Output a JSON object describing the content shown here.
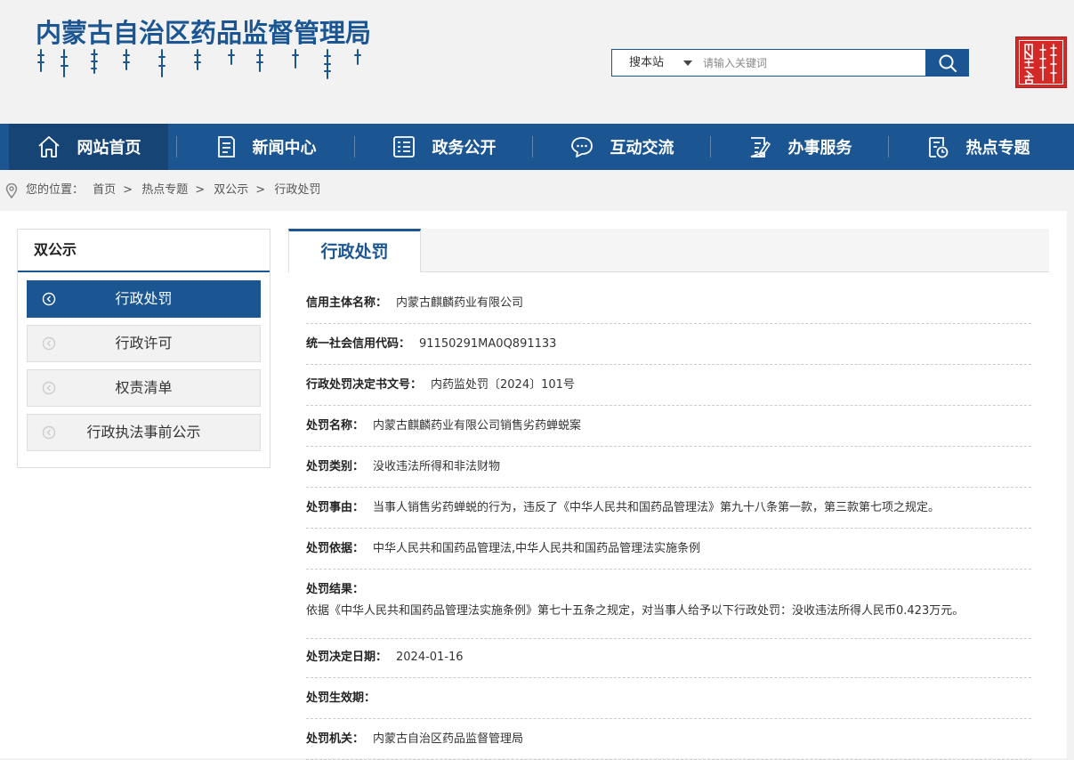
{
  "header": {
    "site_title": "内蒙古自治区药品监督管理局",
    "search": {
      "scope_label": "搜本站",
      "placeholder": "请输入关键词"
    },
    "seal_text": "内蒙古"
  },
  "nav": {
    "items": [
      {
        "label": "网站首页",
        "icon": "home-icon"
      },
      {
        "label": "新闻中心",
        "icon": "document-icon"
      },
      {
        "label": "政务公开",
        "icon": "list-panel-icon"
      },
      {
        "label": "互动交流",
        "icon": "chat-icon"
      },
      {
        "label": "办事服务",
        "icon": "edit-form-icon"
      },
      {
        "label": "热点专题",
        "icon": "clipboard-clock-icon"
      }
    ]
  },
  "breadcrumb": {
    "prefix": "您的位置：",
    "items": [
      "首页",
      "热点专题",
      "双公示",
      "行政处罚"
    ],
    "separator": ">"
  },
  "sidebar": {
    "title": "双公示",
    "items": [
      {
        "label": "行政处罚"
      },
      {
        "label": "行政许可"
      },
      {
        "label": "权责清单"
      },
      {
        "label": "行政执法事前公示"
      }
    ]
  },
  "content": {
    "tab_label": "行政处罚",
    "fields": [
      {
        "key": "信用主体名称：",
        "value": "内蒙古麒麟药业有限公司"
      },
      {
        "key": "统一社会信用代码：",
        "value": "91150291MA0Q891133"
      },
      {
        "key": "行政处罚决定书文号：",
        "value": "内药监处罚〔2024〕101号"
      },
      {
        "key": "处罚名称：",
        "value": "内蒙古麒麟药业有限公司销售劣药蝉蜕案"
      },
      {
        "key": "处罚类别：",
        "value": "没收违法所得和非法财物"
      },
      {
        "key": "处罚事由：",
        "value": "当事人销售劣药蝉蜕的行为，违反了《中华人民共和国药品管理法》第九十八条第一款，第三款第七项之规定。"
      },
      {
        "key": "处罚依据：",
        "value": "中华人民共和国药品管理法,中华人民共和国药品管理法实施条例"
      },
      {
        "key": "处罚结果：",
        "value": "依据《中华人民共和国药品管理法实施条例》第七十五条之规定，对当事人给予以下行政处罚：没收违法所得人民币0.423万元。"
      },
      {
        "key": "处罚决定日期：",
        "value": "2024-01-16"
      },
      {
        "key": "处罚生效期：",
        "value": ""
      },
      {
        "key": "处罚机关：",
        "value": "内蒙古自治区药品监督管理局"
      }
    ]
  },
  "colors": {
    "brand_blue": "#1b5693",
    "nav_active": "#164474",
    "seal_red": "#d32a28"
  }
}
